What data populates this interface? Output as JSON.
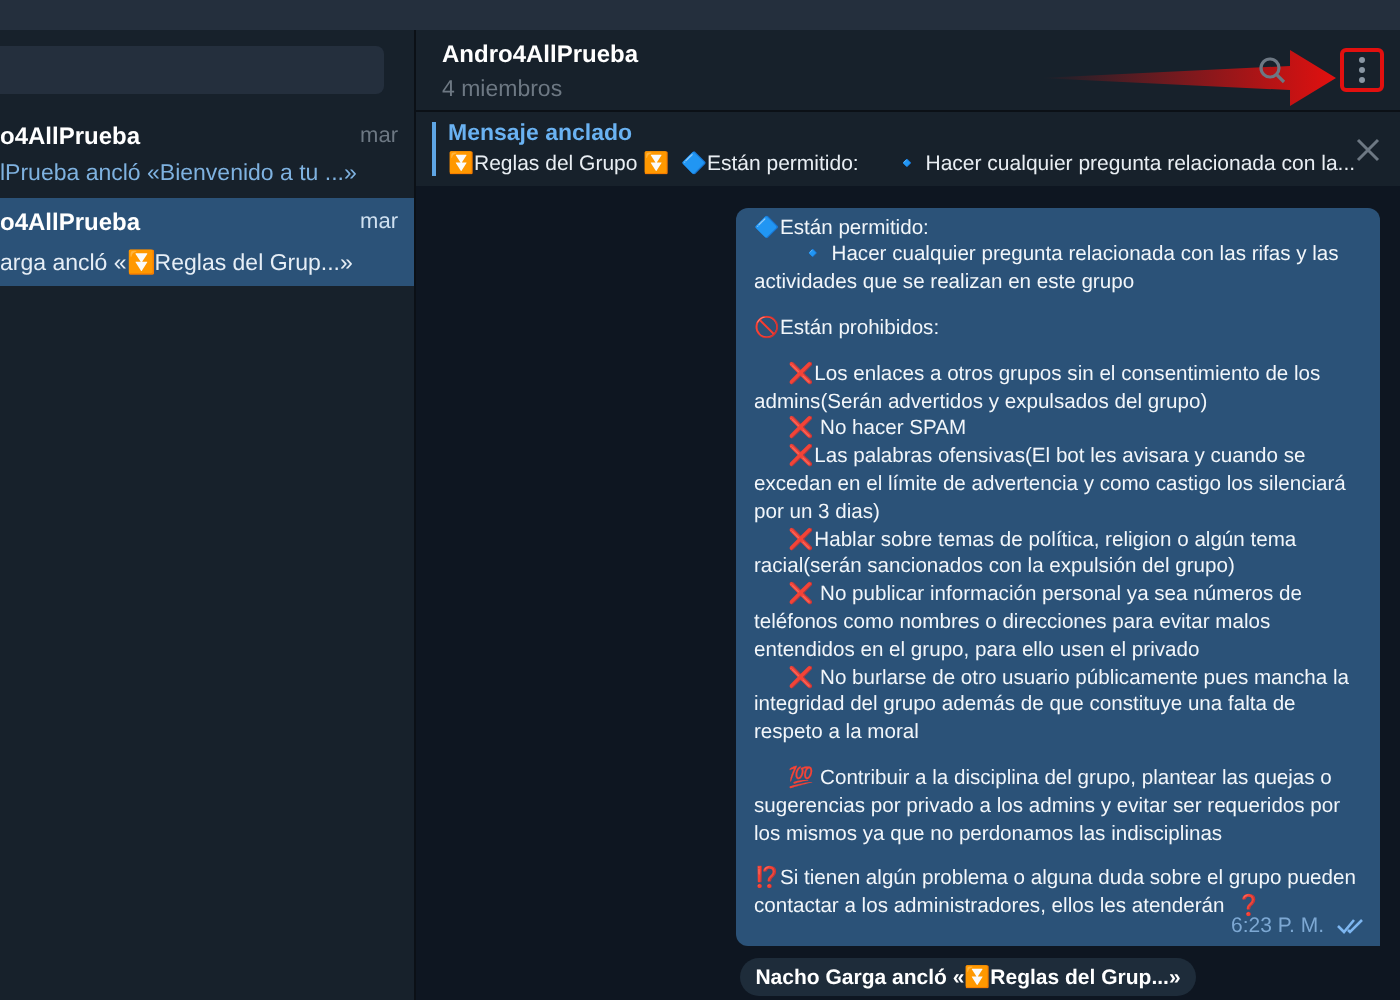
{
  "sidebar": {
    "chats": [
      {
        "name": "o4AllPrueba",
        "time": "mar",
        "preview": "lPrueba ancló «Bienvenido a tu ...»",
        "selected": false
      },
      {
        "name": "o4AllPrueba",
        "time": "mar",
        "preview": "arga ancló «⏬Reglas del Grup...»",
        "selected": true
      }
    ]
  },
  "header": {
    "title": "Andro4AllPrueba",
    "subtitle": "4 miembros",
    "menu_highlighted": true
  },
  "pinned": {
    "label": "Mensaje anclado",
    "text": "⏬Reglas del Grupo ⏬  🔷Están permitido:      🔹 Hacer cualquier pregunta relacionada con la..."
  },
  "message": {
    "paragraphs": [
      [
        "🔷Están permitido:",
        "        🔹 Hacer cualquier pregunta relacionada con las rifas y las actividades que se realizan en este grupo"
      ],
      [
        "🚫Están prohibidos:"
      ],
      [
        "      ❌Los enlaces a otros grupos sin el consentimiento de los admins(Serán advertidos y expulsados del grupo)",
        "      ❌ No hacer SPAM",
        "      ❌Las palabras ofensivas(El bot les avisara y cuando se excedan en el límite de advertencia y como castigo los silenciará por un 3 dias)",
        "      ❌Hablar sobre temas de política, religion o algún tema racial(serán sancionados con la expulsión del grupo)",
        "      ❌ No publicar información personal ya sea números de teléfonos como nombres o direcciones para evitar malos entendidos en el grupo, para ello usen el privado",
        "      ❌ No burlarse de otro usuario públicamente pues mancha la integridad del grupo además de que constituye una falta de respeto a la moral"
      ],
      [
        "      💯 Contribuir a la disciplina del grupo, plantear las quejas o sugerencias por privado a los admins y evitar ser requeridos por los mismos ya que no perdonamos las indisciplinas"
      ],
      [
        "⁉️Si tienen algún problema o alguna duda sobre el grupo pueden contactar a los administradores, ellos les atenderán  ❓"
      ]
    ],
    "time": "6:23 P. M.",
    "read": true
  },
  "service_message": "Nacho Garga ancló «⏬Reglas del Grup...»"
}
